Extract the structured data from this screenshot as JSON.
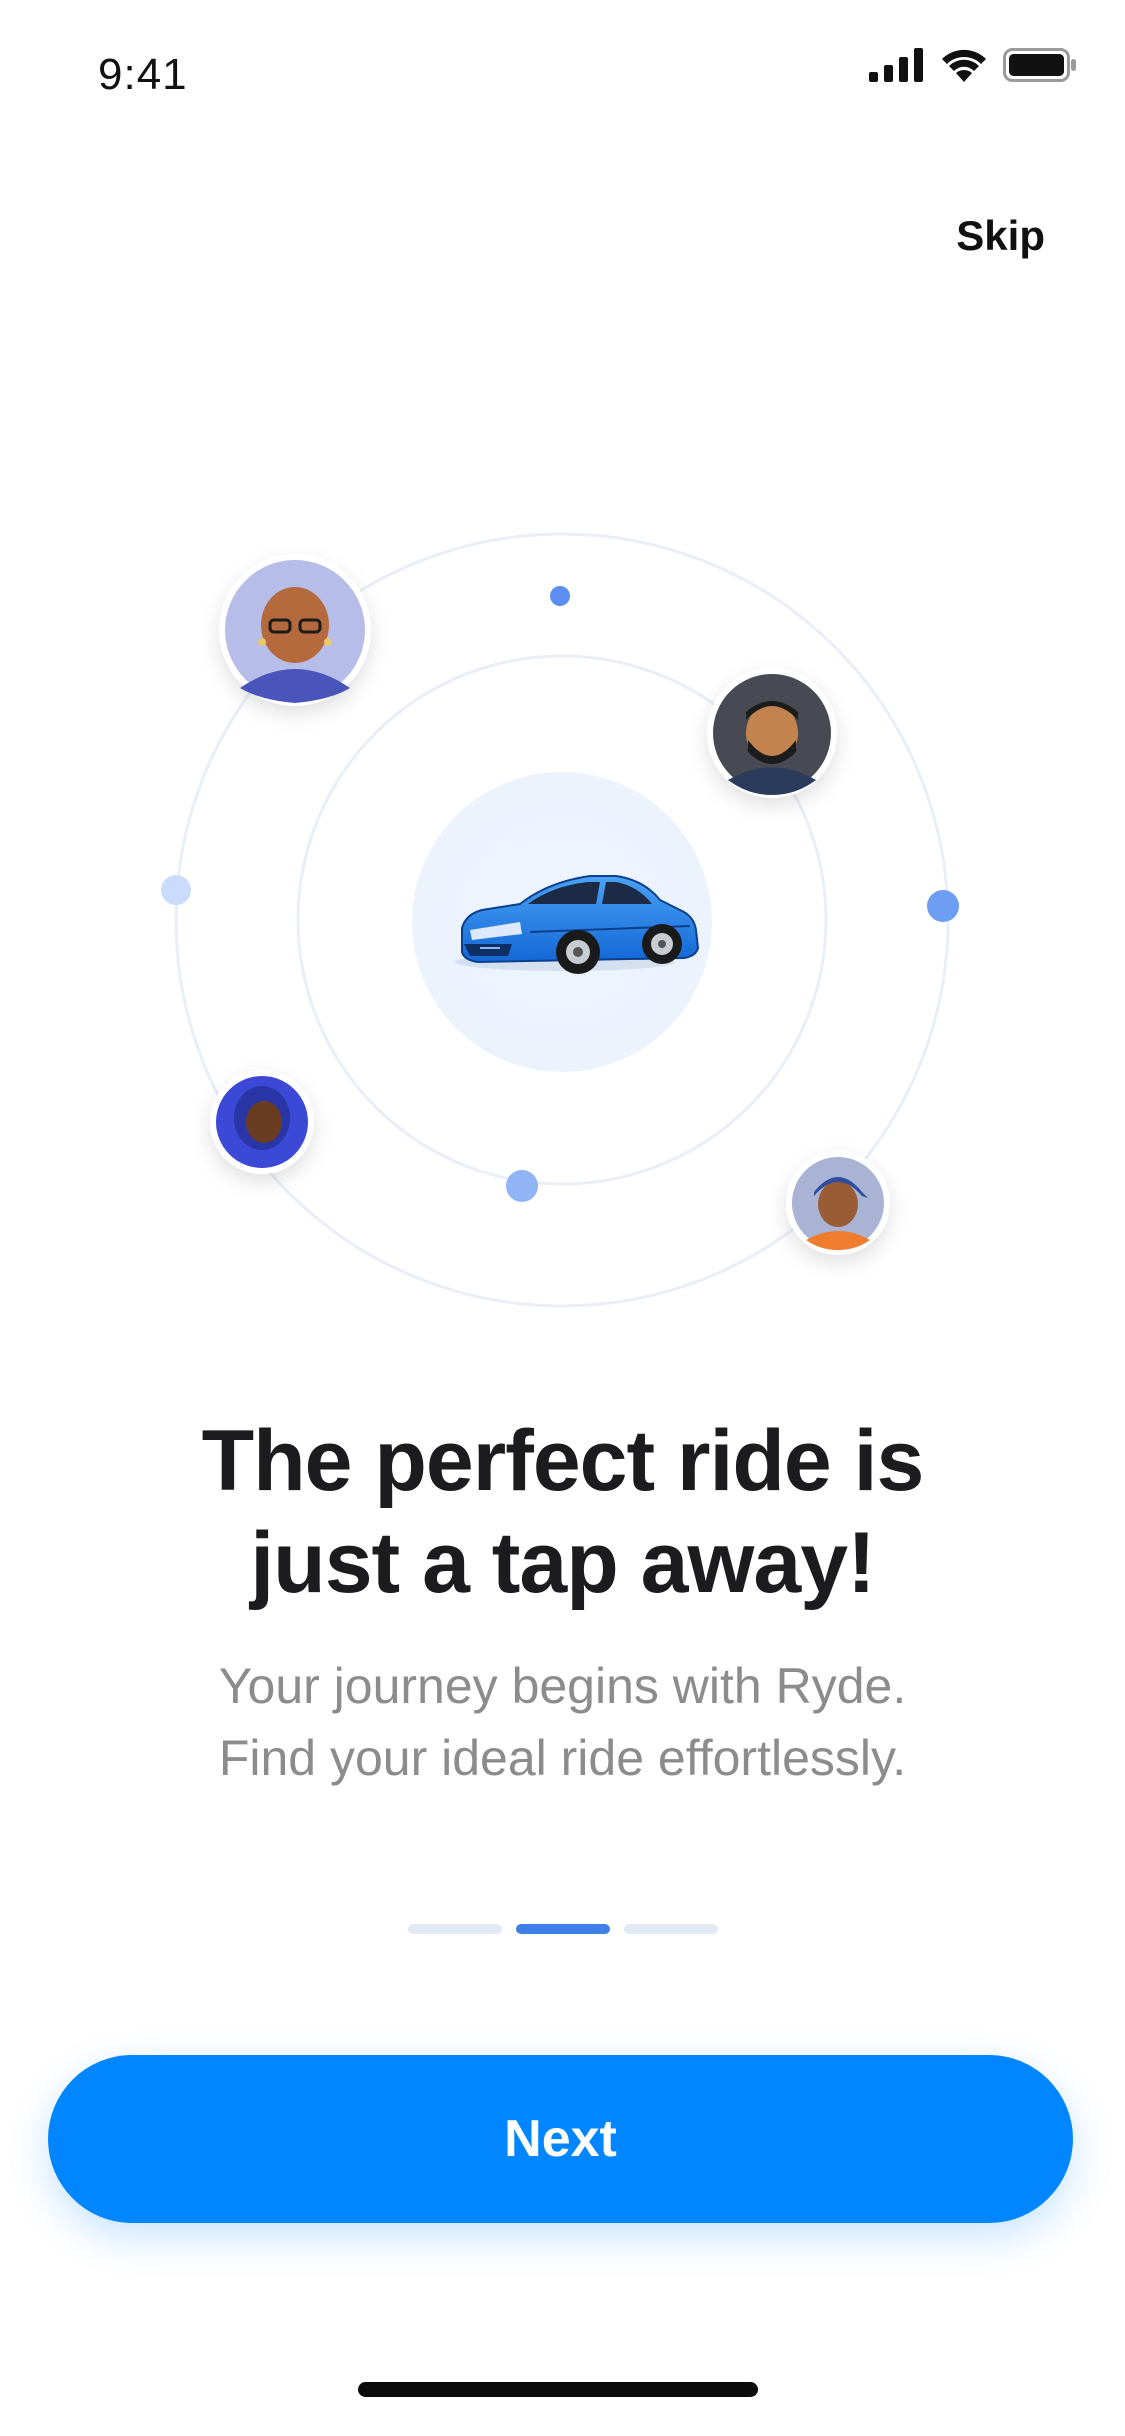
{
  "status_bar": {
    "time": "9:41",
    "icons": [
      "signal-icon",
      "wifi-icon",
      "battery-icon"
    ]
  },
  "header": {
    "skip_label": "Skip"
  },
  "illustration": {
    "center_icon": "car-icon",
    "avatars": [
      "avatar-bald-glasses",
      "avatar-bearded-man",
      "avatar-hijab-woman",
      "avatar-cap-man"
    ],
    "ring_color": "#e8edf6",
    "accent_dot_color": "#5b8ef0"
  },
  "content": {
    "headline_line1": "The perfect ride is",
    "headline_line2": "just a tap away!",
    "subtitle_line1": "Your journey begins with Ryde.",
    "subtitle_line2": "Find your ideal ride effortlessly."
  },
  "pagination": {
    "total": 3,
    "active_index": 1
  },
  "footer": {
    "next_label": "Next"
  },
  "colors": {
    "primary": "#0286ff",
    "active_dot": "#3e7fe8",
    "inactive_dot": "#e3e9f3",
    "headline": "#1c1c1e",
    "subtitle": "#8c8c8c"
  }
}
